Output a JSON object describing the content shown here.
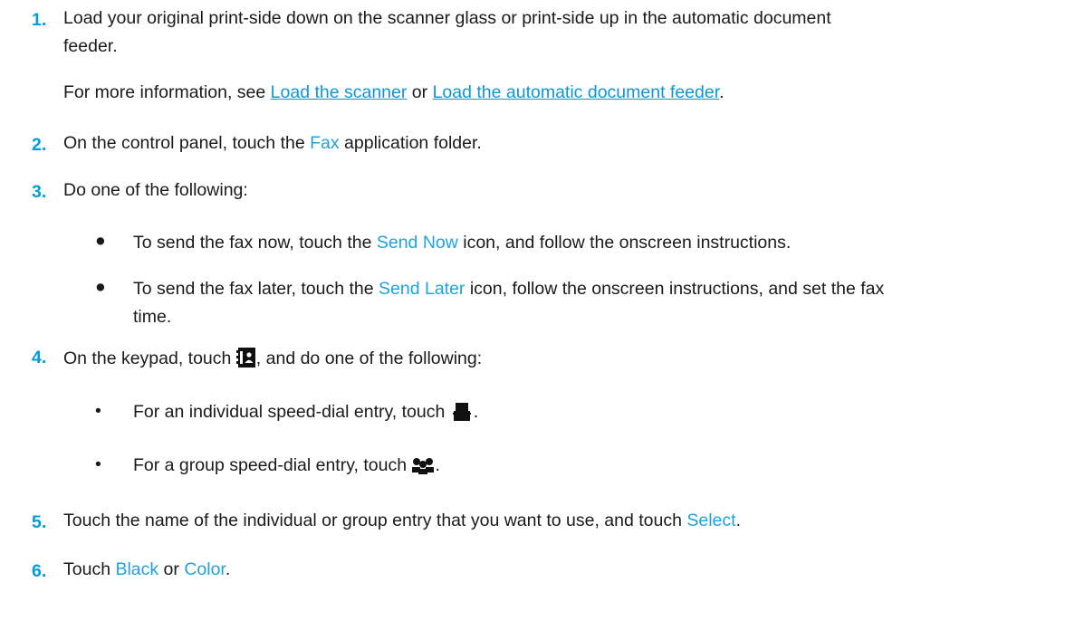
{
  "steps": [
    {
      "num": "1.",
      "line1": "Load your original print-side down on the scanner glass or print-side up in the automatic document",
      "line2": "feeder.",
      "note": {
        "prefix": "For more information, see ",
        "link1": "Load the scanner",
        "mid": " or ",
        "link2": "Load the automatic document feeder",
        "suffix": "."
      }
    },
    {
      "num": "2.",
      "pre": "On the control panel, touch the ",
      "hl": "Fax",
      "post": " application folder."
    },
    {
      "num": "3.",
      "text": "Do one of the following:",
      "bullets": [
        {
          "mark": "●",
          "pre": "To send the fax now, touch the ",
          "hl": "Send Now",
          "post": " icon, and follow the onscreen instructions."
        },
        {
          "mark": "●",
          "pre": "To send the fax later, touch the ",
          "hl": "Send Later",
          "post": " icon, follow the onscreen instructions, and set the fax",
          "line2": "time."
        }
      ]
    },
    {
      "num": "4.",
      "pre": "On the keypad, touch ",
      "icon": "speed-dial-book-icon",
      "post": ", and do one of the following:",
      "bullets": [
        {
          "mark": "•",
          "pre": "For an individual speed-dial entry, touch ",
          "icon": "individual-contact-icon",
          "post": "."
        },
        {
          "mark": "•",
          "pre": "For a group speed-dial entry, touch ",
          "icon": "group-contact-icon",
          "post": "."
        }
      ]
    },
    {
      "num": "5.",
      "pre": "Touch the name of the individual or group entry that you want to use, and touch ",
      "hl": "Select",
      "post": "."
    },
    {
      "num": "6.",
      "pre": "Touch ",
      "hl1": "Black",
      "mid": " or ",
      "hl2": "Color",
      "post": "."
    }
  ],
  "colors": {
    "step_number": "#009dd8",
    "ui_term": "#1fa3dc",
    "link": "#1096d3"
  }
}
